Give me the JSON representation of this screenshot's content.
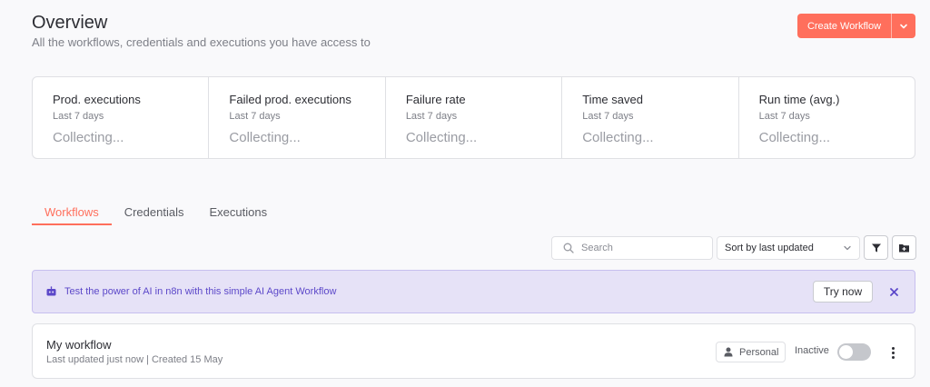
{
  "header": {
    "title": "Overview",
    "subtitle": "All the workflows, credentials and executions you have access to",
    "create_button": "Create Workflow"
  },
  "stats": [
    {
      "title": "Prod. executions",
      "period": "Last 7 days",
      "value": "Collecting..."
    },
    {
      "title": "Failed prod. executions",
      "period": "Last 7 days",
      "value": "Collecting..."
    },
    {
      "title": "Failure rate",
      "period": "Last 7 days",
      "value": "Collecting..."
    },
    {
      "title": "Time saved",
      "period": "Last 7 days",
      "value": "Collecting..."
    },
    {
      "title": "Run time (avg.)",
      "period": "Last 7 days",
      "value": "Collecting..."
    }
  ],
  "tabs": [
    {
      "label": "Workflows",
      "active": true
    },
    {
      "label": "Credentials",
      "active": false
    },
    {
      "label": "Executions",
      "active": false
    }
  ],
  "toolbar": {
    "search_placeholder": "Search",
    "sort_value": "Sort by last updated"
  },
  "banner": {
    "text": "Test the power of AI in n8n with this simple AI Agent Workflow",
    "button": "Try now"
  },
  "workflow": {
    "name": "My workflow",
    "meta": "Last updated just now | Created 15 May",
    "owner": "Personal",
    "status": "Inactive",
    "active": false
  },
  "colors": {
    "accent": "#ff6f5c",
    "banner_bg": "#e6e2f7",
    "banner_text": "#5c48c9"
  },
  "icons": [
    "chevron-down-icon",
    "search-icon",
    "filter-icon",
    "folder-add-icon",
    "robot-icon",
    "close-icon",
    "user-icon",
    "more-vertical-icon"
  ]
}
